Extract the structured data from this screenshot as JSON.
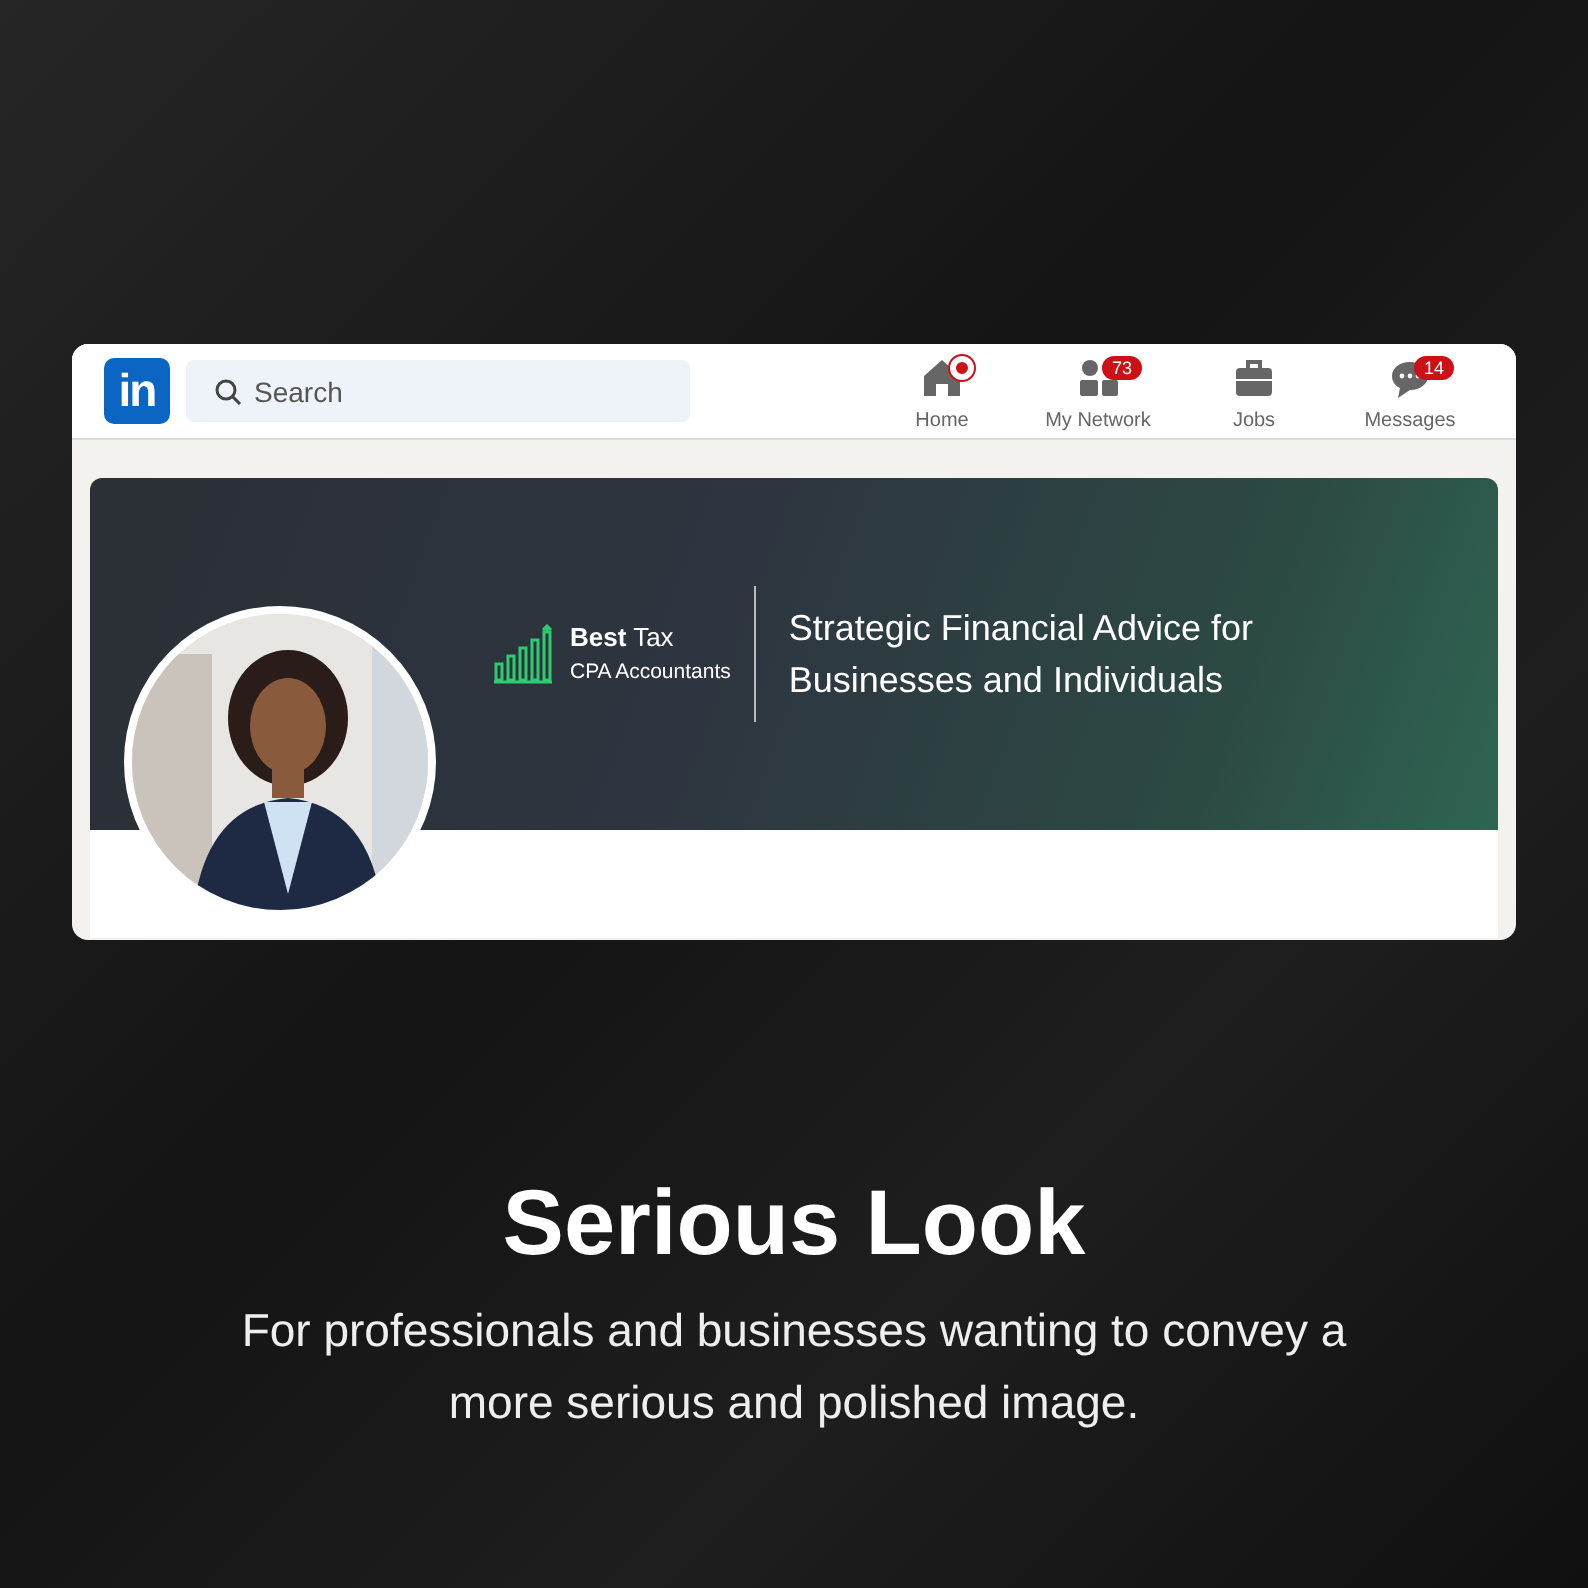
{
  "app": {
    "logo": "in",
    "search": {
      "placeholder": "Search"
    },
    "nav": [
      {
        "kind": "home",
        "label": "Home",
        "notification_dot": true
      },
      {
        "kind": "network",
        "label": "My Network",
        "badge": "73"
      },
      {
        "kind": "jobs",
        "label": "Jobs"
      },
      {
        "kind": "messages",
        "label": "Messages",
        "badge": "14"
      }
    ],
    "banner": {
      "brand_name": "**Best** Tax",
      "brand_subtitle": "CPA Accountants",
      "tagline": "Strategic Financial Advice for Businesses and Individuals"
    }
  },
  "headline": "Serious Look",
  "description": "For professionals and businesses wanting to convey a more serious and polished image."
}
